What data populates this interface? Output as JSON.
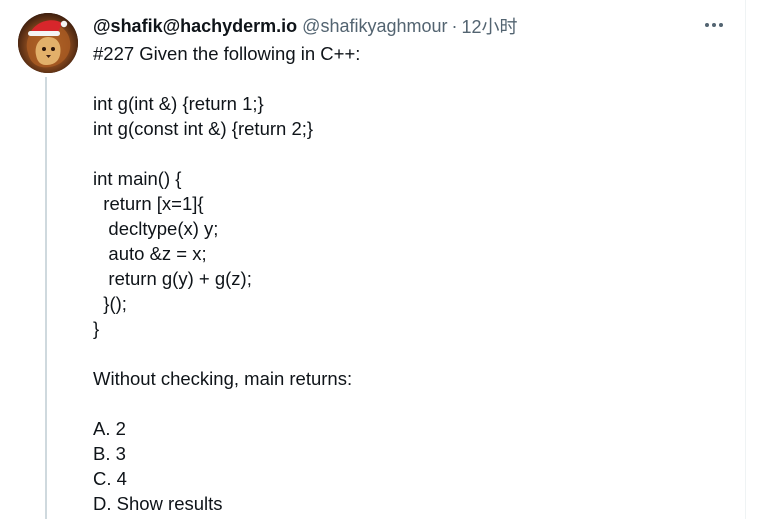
{
  "author": {
    "display_name": "@shafik@hachyderm.io",
    "handle": "@shafikyaghmour",
    "separator": "·",
    "time": "12小时",
    "avatar_icon": "avatar-lion-santa-hat-icon"
  },
  "menu": {
    "icon": "more-horizontal-icon"
  },
  "post": {
    "lines": [
      "#227 Given the following in C++:",
      "",
      "int g(int &) {return 1;}",
      "int g(const int &) {return 2;}",
      "",
      "int main() {",
      "  return [x=1]{",
      "   decltype(x) y;",
      "   auto &z = x;",
      "   return g(y) + g(z);",
      "  }();",
      "}",
      "",
      "Without checking, main returns:",
      "",
      "A. 2",
      "B. 3",
      "C. 4",
      "D. Show results"
    ]
  },
  "colors": {
    "text": "#0f1419",
    "secondary_text": "#536471",
    "thread_line": "#cfd9de",
    "divider": "#eff3f4"
  }
}
